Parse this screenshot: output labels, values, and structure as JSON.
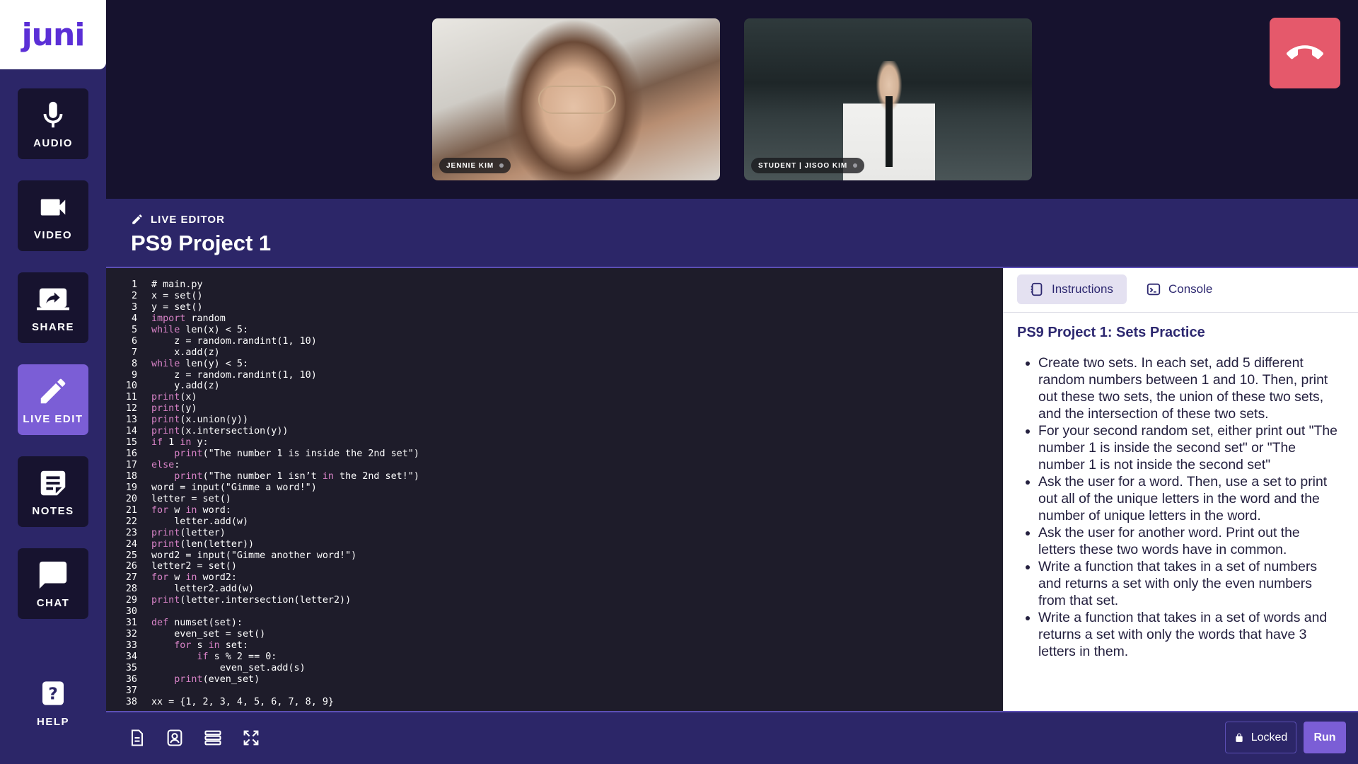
{
  "logo": {
    "text": "juni"
  },
  "sidebar": {
    "items": [
      {
        "label": "AUDIO",
        "icon": "microphone-icon"
      },
      {
        "label": "VIDEO",
        "icon": "video-camera-icon"
      },
      {
        "label": "SHARE",
        "icon": "screen-share-icon"
      },
      {
        "label": "LIVE EDIT",
        "icon": "pencil-icon",
        "active": true
      },
      {
        "label": "NOTES",
        "icon": "notes-icon"
      },
      {
        "label": "CHAT",
        "icon": "chat-bubble-icon"
      }
    ],
    "help_label": "HELP"
  },
  "videos": [
    {
      "name": "JENNIE KIM"
    },
    {
      "name": "STUDENT | JISOO KIM"
    }
  ],
  "editor": {
    "sub_label": "LIVE EDITOR",
    "title": "PS9 Project 1"
  },
  "code": {
    "lines": [
      "# main.py",
      "x = set()",
      "y = set()",
      "import random",
      "while len(x) < 5:",
      "    z = random.randint(1, 10)",
      "    x.add(z)",
      "while len(y) < 5:",
      "    z = random.randint(1, 10)",
      "    y.add(z)",
      "print(x)",
      "print(y)",
      "print(x.union(y))",
      "print(x.intersection(y))",
      "if 1 in y:",
      "    print(\"The number 1 is inside the 2nd set\")",
      "else:",
      "    print(\"The number 1 isn’t in the 2nd set!\")",
      "word = input(\"Gimme a word!\")",
      "letter = set()",
      "for w in word:",
      "    letter.add(w)",
      "print(letter)",
      "print(len(letter))",
      "word2 = input(\"Gimme another word!\")",
      "letter2 = set()",
      "for w in word2:",
      "    letter2.add(w)",
      "print(letter.intersection(letter2))",
      "",
      "def numset(set):",
      "    even_set = set()",
      "    for s in set:",
      "        if s % 2 == 0:",
      "            even_set.add(s)",
      "    print(even_set)",
      "",
      "xx = {1, 2, 3, 4, 5, 6, 7, 8, 9}"
    ]
  },
  "tabs": [
    {
      "label": "Instructions",
      "active": true
    },
    {
      "label": "Console",
      "active": false
    }
  ],
  "instructions": {
    "title": "PS9 Project 1: Sets Practice",
    "items": [
      "Create two sets. In each set, add 5 different random numbers between 1 and 10. Then, print out these two sets, the union of these two sets, and the intersection of these two sets.",
      "For your second random set, either print out \"The number 1 is inside the second set\" or \"The number 1 is not inside the second set\"",
      "Ask the user for a word. Then, use a set to print out all of the unique letters in the word and the number of unique letters in the word.",
      "Ask the user for another word. Print out the letters these two words have in common.",
      "Write a function that takes in a set of numbers and returns a set with only the even numbers from that set.",
      "Write a function that takes in a set of words and returns a set with only the words that have 3 letters in them."
    ]
  },
  "bottom_bar": {
    "icons": [
      "document-icon",
      "user-badge-icon",
      "layers-icon",
      "fullscreen-icon"
    ],
    "locked_label": "Locked",
    "run_label": "Run"
  },
  "colors": {
    "sidebar": "#2c2668",
    "background": "#16122e",
    "accent": "#7b5ed6",
    "hangup": "#e5596b",
    "code_bg": "#1e1c2a",
    "keyword": "#d883c7"
  }
}
